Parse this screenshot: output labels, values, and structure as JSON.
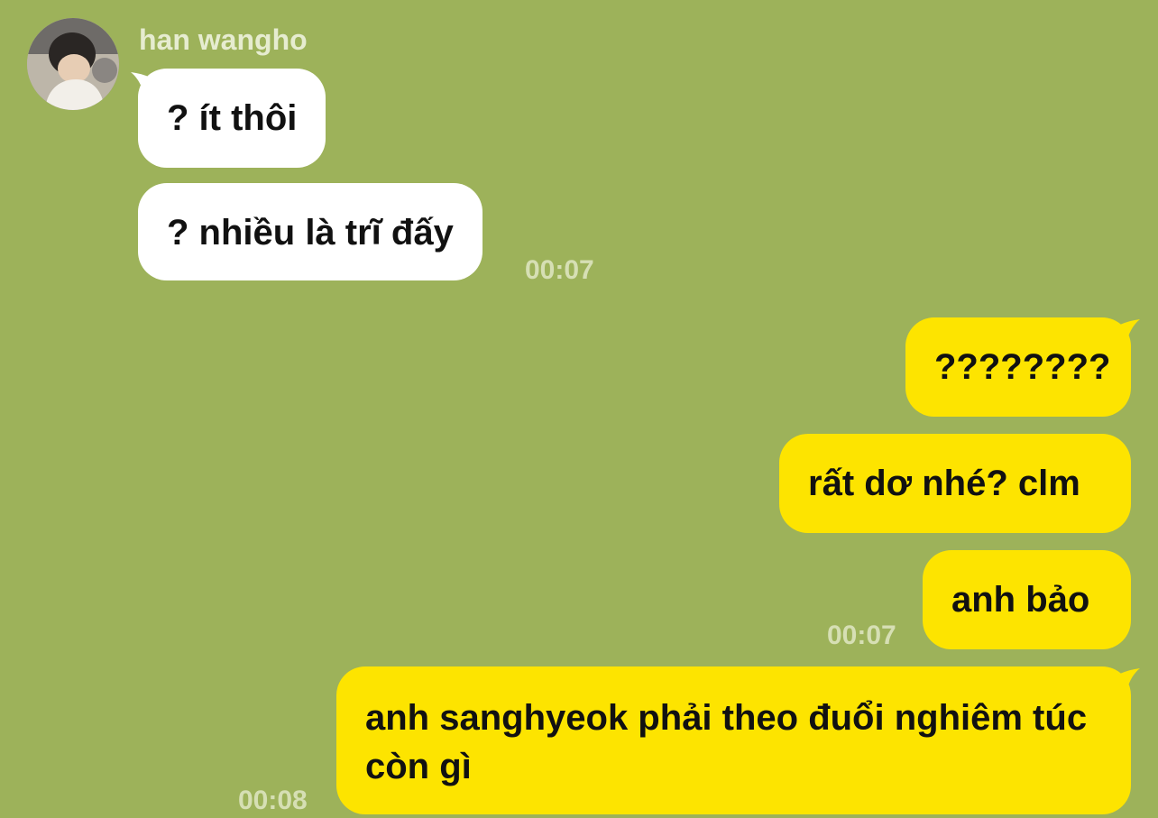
{
  "chat": {
    "sender_name": "han wangho",
    "incoming": [
      {
        "text": "? ít thôi"
      },
      {
        "text": "? nhiều là trĩ đấy"
      }
    ],
    "incoming_time": "00:07",
    "outgoing": [
      {
        "text": "????????"
      },
      {
        "text": "rất dơ nhé? clm"
      },
      {
        "text": "anh bảo"
      },
      {
        "text": "anh sanghyeok phải theo đuổi nghiêm túc còn gì"
      }
    ],
    "outgoing_time_1": "00:07",
    "outgoing_time_2": "00:08"
  },
  "colors": {
    "background": "#9db25a",
    "incoming_bubble": "#ffffff",
    "outgoing_bubble": "#fde400",
    "timestamp": "#d6dfb4"
  },
  "icons": {
    "avatar": "profile-photo-avatar"
  }
}
